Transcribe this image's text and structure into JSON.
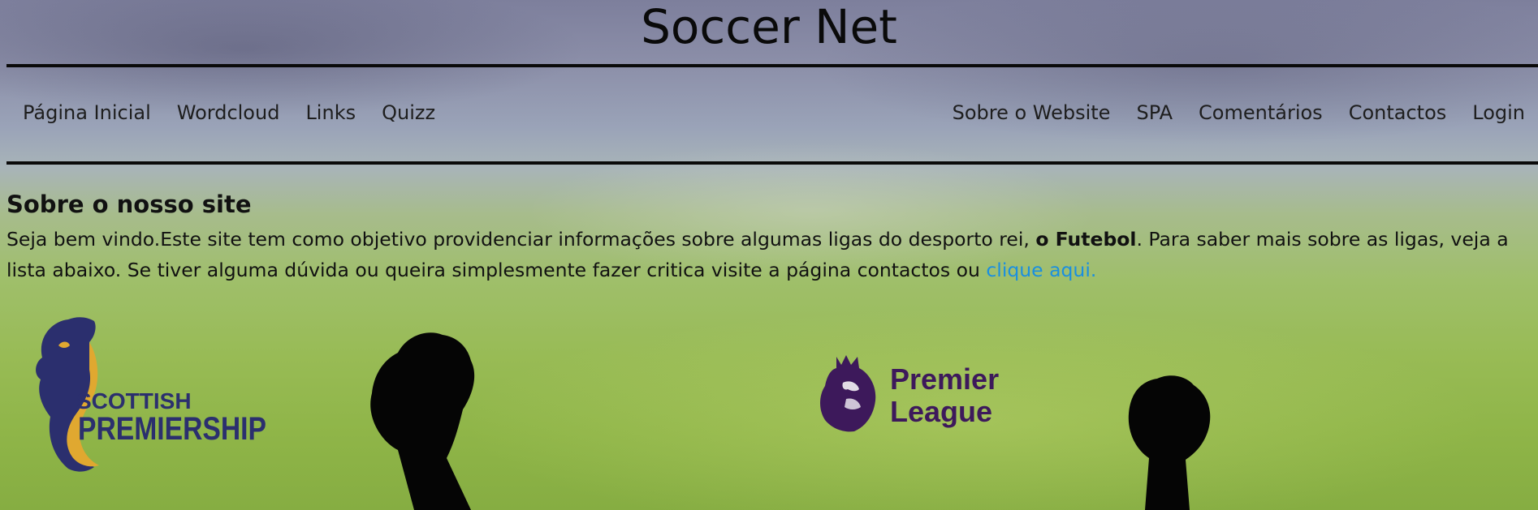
{
  "header": {
    "title": "Soccer Net"
  },
  "nav": {
    "left": [
      {
        "label": "Página Inicial"
      },
      {
        "label": "Wordcloud"
      },
      {
        "label": "Links"
      },
      {
        "label": "Quizz"
      }
    ],
    "right": [
      {
        "label": "Sobre o Website"
      },
      {
        "label": "SPA"
      },
      {
        "label": "Comentários"
      },
      {
        "label": "Contactos"
      },
      {
        "label": "Login"
      }
    ]
  },
  "about": {
    "heading": "Sobre o nosso site",
    "text_before": "Seja bem vindo.Este site tem como objetivo providenciar informações sobre algumas ligas do desporto rei, ",
    "text_bold": "o Futebol",
    "text_after": ". Para saber mais sobre as ligas, veja a lista abaixo. Se tiver alguma dúvida ou queira simplesmente fazer critica visite a página contactos ou ",
    "link_label": "clique aqui."
  },
  "leagues": [
    {
      "name": "SCOTTISH PREMIERSHIP",
      "line1": "SCOTTISH",
      "line2": "PREMIERSHIP",
      "icon": "lion-rampant-icon"
    },
    {
      "name": "Premier League",
      "line1": "Premier",
      "line2": "League",
      "icon": "lion-crown-icon"
    }
  ],
  "colors": {
    "link": "#1a8fe0",
    "scottish_navy": "#2b2f6e",
    "scottish_gold": "#e0a830",
    "premier_purple": "#3d195b"
  }
}
